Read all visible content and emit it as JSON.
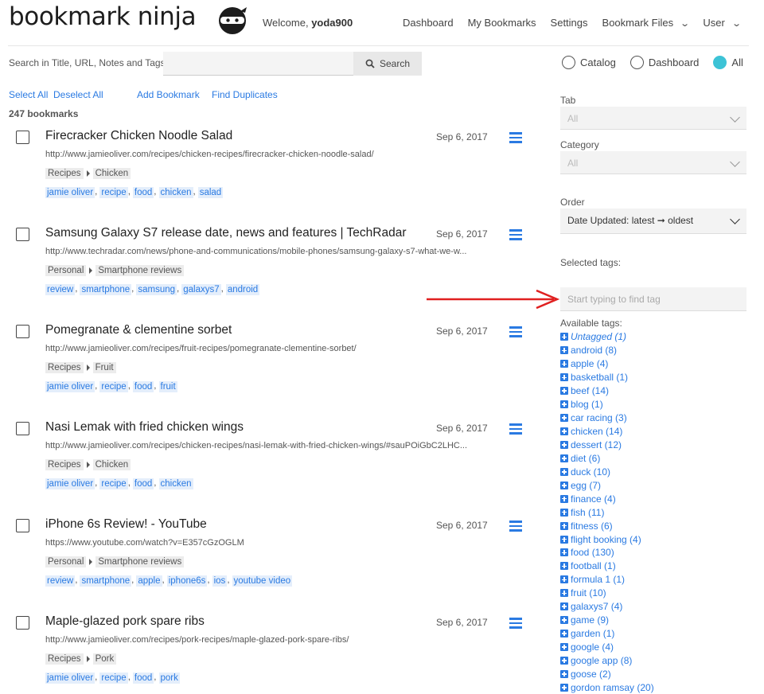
{
  "header": {
    "logo": "bookmark ninja",
    "welcome_prefix": "Welcome,",
    "username": "yoda900",
    "nav": [
      "Dashboard",
      "My Bookmarks",
      "Settings",
      "Bookmark Files",
      "User"
    ]
  },
  "search": {
    "label": "Search in Title, URL, Notes and Tags:",
    "placeholder": "",
    "button": "Search"
  },
  "view_modes": {
    "options": [
      "Catalog",
      "Dashboard",
      "All"
    ],
    "selected": "All"
  },
  "actions": {
    "select_all": "Select All",
    "deselect_all": "Deselect All",
    "add_bookmark": "Add Bookmark",
    "find_duplicates": "Find Duplicates"
  },
  "count_label": "247 bookmarks",
  "bookmarks": [
    {
      "title": "Firecracker Chicken Noodle Salad",
      "date": "Sep 6, 2017",
      "url": "http://www.jamieoliver.com/recipes/chicken-recipes/firecracker-chicken-noodle-salad/",
      "tab": "Recipes",
      "category": "Chicken",
      "tags": [
        "jamie oliver",
        "recipe",
        "food",
        "chicken",
        "salad"
      ]
    },
    {
      "title": "Samsung Galaxy S7 release date, news and features | TechRadar",
      "date": "Sep 6, 2017",
      "url": "http://www.techradar.com/news/phone-and-communications/mobile-phones/samsung-galaxy-s7-what-we-w...",
      "tab": "Personal",
      "category": "Smartphone reviews",
      "tags": [
        "review",
        "smartphone",
        "samsung",
        "galaxys7",
        "android"
      ]
    },
    {
      "title": "Pomegranate & clementine sorbet",
      "date": "Sep 6, 2017",
      "url": "http://www.jamieoliver.com/recipes/fruit-recipes/pomegranate-clementine-sorbet/",
      "tab": "Recipes",
      "category": "Fruit",
      "tags": [
        "jamie oliver",
        "recipe",
        "food",
        "fruit"
      ]
    },
    {
      "title": "Nasi Lemak with fried chicken wings",
      "date": "Sep 6, 2017",
      "url": "http://www.jamieoliver.com/recipes/chicken-recipes/nasi-lemak-with-fried-chicken-wings/#sauPOiGbC2LHC...",
      "tab": "Recipes",
      "category": "Chicken",
      "tags": [
        "jamie oliver",
        "recipe",
        "food",
        "chicken"
      ]
    },
    {
      "title": "iPhone 6s Review! - YouTube",
      "date": "Sep 6, 2017",
      "url": "https://www.youtube.com/watch?v=E357cGzOGLM",
      "tab": "Personal",
      "category": "Smartphone reviews",
      "tags": [
        "review",
        "smartphone",
        "apple",
        "iphone6s",
        "ios",
        "youtube video"
      ]
    },
    {
      "title": "Maple-glazed pork spare ribs",
      "date": "Sep 6, 2017",
      "url": "http://www.jamieoliver.com/recipes/pork-recipes/maple-glazed-pork-spare-ribs/",
      "tab": "Recipes",
      "category": "Pork",
      "tags": [
        "jamie oliver",
        "recipe",
        "food",
        "pork"
      ]
    }
  ],
  "filters": {
    "tab_label": "Tab",
    "tab_value": "All",
    "category_label": "Category",
    "category_value": "All",
    "order_label": "Order",
    "order_value": "Date Updated: latest ➞ oldest",
    "selected_tags_label": "Selected tags:",
    "tag_search_placeholder": "Start typing to find tag",
    "available_label": "Available tags:",
    "available_tags": [
      "Untagged (1)",
      "android (8)",
      "apple (4)",
      "basketball (1)",
      "beef (14)",
      "blog (1)",
      "car racing (3)",
      "chicken (14)",
      "dessert (12)",
      "diet (6)",
      "duck (10)",
      "egg (7)",
      "finance (4)",
      "fish (11)",
      "fitness (6)",
      "flight booking (4)",
      "food (130)",
      "football (1)",
      "formula 1 (1)",
      "fruit (10)",
      "galaxys7 (4)",
      "game (9)",
      "garden (1)",
      "google (4)",
      "google app (8)",
      "goose (2)",
      "gordon ramsay (20)"
    ]
  },
  "colors": {
    "accent": "#2a7ae2",
    "radio_on": "#3dc3d6",
    "arrow": "#e02020"
  }
}
